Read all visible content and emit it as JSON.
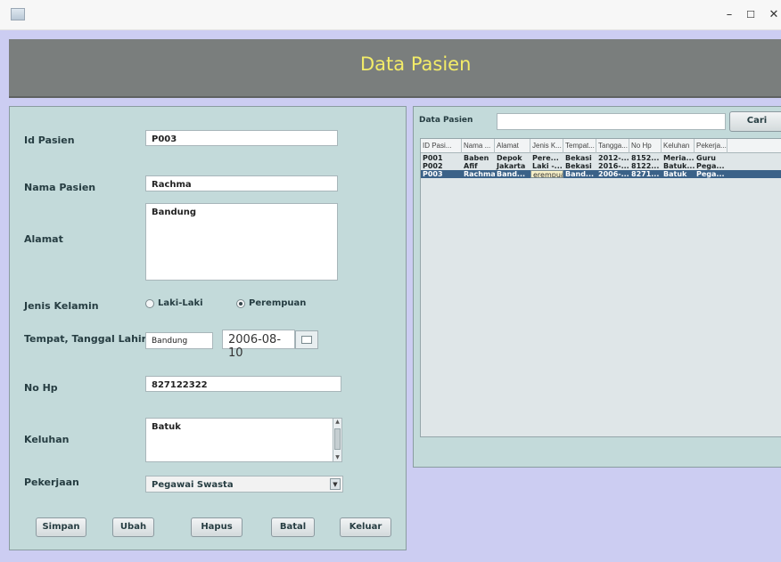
{
  "window": {
    "minimize_glyph": "–",
    "maximize_glyph": "☐",
    "close_glyph": "✕"
  },
  "header": {
    "title": "Data Pasien"
  },
  "form": {
    "id_label": "Id Pasien",
    "id_value": "P003",
    "nama_label": "Nama Pasien",
    "nama_value": "Rachma",
    "alamat_label": "Alamat",
    "alamat_value": "Bandung",
    "jk_label": "Jenis Kelamin",
    "jk_option_laki": "Laki-Laki",
    "jk_option_perempuan": "Perempuan",
    "jk_selected": "Perempuan",
    "ttl_label": "Tempat, Tanggal Lahir",
    "tempat_value": "Bandung",
    "tanggal_value": "2006-08-10",
    "nohp_label": "No Hp",
    "nohp_value": "827122322",
    "keluhan_label": "Keluhan",
    "keluhan_value": "Batuk",
    "pekerjaan_label": "Pekerjaan",
    "pekerjaan_value": "Pegawai Swasta",
    "buttons": {
      "simpan": "Simpan",
      "ubah": "Ubah",
      "hapus": "Hapus",
      "batal": "Batal",
      "keluar": "Keluar"
    }
  },
  "search": {
    "label": "Data Pasien",
    "value": "",
    "button": "Cari"
  },
  "table": {
    "headers": [
      "ID Pasi...",
      "Nama ...",
      "Alamat",
      "Jenis K...",
      "Tempat...",
      "Tangga...",
      "No Hp",
      "Keluhan",
      "Pekerja..."
    ],
    "rows": [
      [
        "P001",
        "Baben",
        "Depok",
        "Pere...",
        "Bekasi",
        "2012-...",
        "8152...",
        "Meria...",
        "Guru"
      ],
      [
        "P002",
        "Afif",
        "Jakarta",
        "Laki -...",
        "Bekasi",
        "2016-...",
        "8122...",
        "Batuk...",
        "Pega..."
      ],
      [
        "P003",
        "Rachma",
        "Band...",
        "erempuan",
        "Band...",
        "2006-...",
        "8271...",
        "Batuk",
        "Pega..."
      ]
    ],
    "selected_row_index": 2,
    "selection_color": "#3b6288"
  },
  "colors": {
    "background": "#cccdf2",
    "header_bg": "#7a7e7d",
    "header_text": "#f3ec68",
    "panel_bg": "#c3dada"
  }
}
